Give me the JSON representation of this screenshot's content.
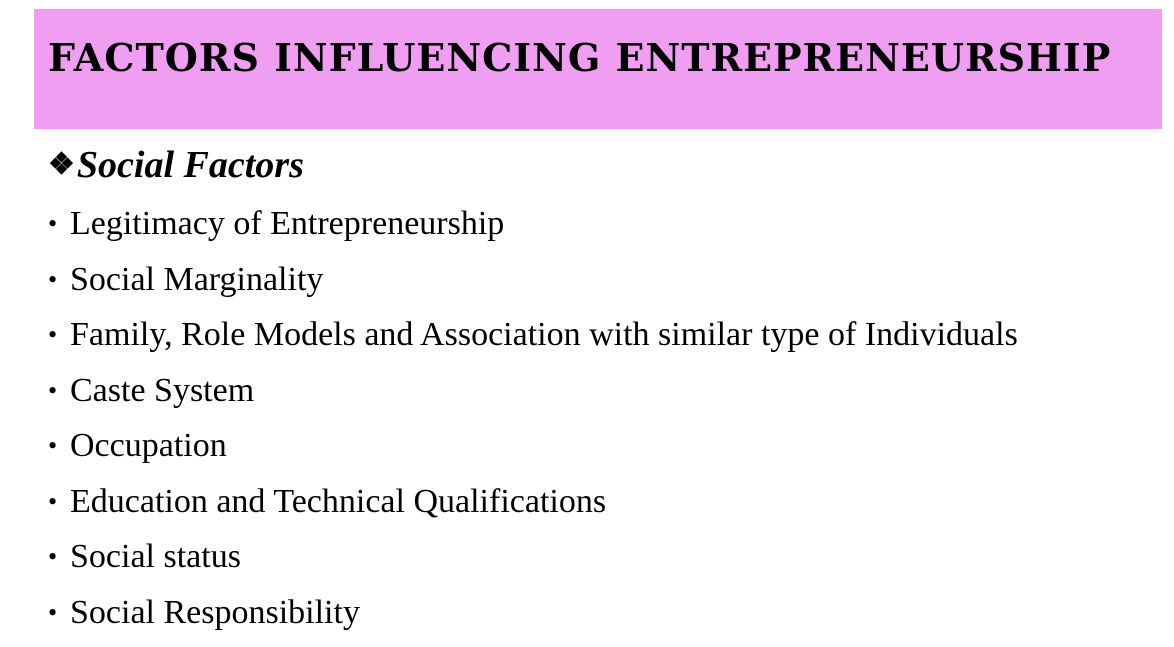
{
  "title": "FACTORS INFLUENCING ENTREPRENEURSHIP",
  "subhead": {
    "icon": "diamond-bullet-icon",
    "glyph": "❖",
    "label": "Social Factors"
  },
  "bullet_glyph": "•",
  "items": [
    "Legitimacy of Entrepreneurship",
    "Social Marginality",
    "Family, Role Models and Association with similar type of Individuals",
    "Caste System",
    "Occupation",
    "Education and Technical Qualifications",
    "Social status",
    "Social Responsibility"
  ],
  "colors": {
    "title_background": "#f09ef2",
    "text": "#000000"
  }
}
